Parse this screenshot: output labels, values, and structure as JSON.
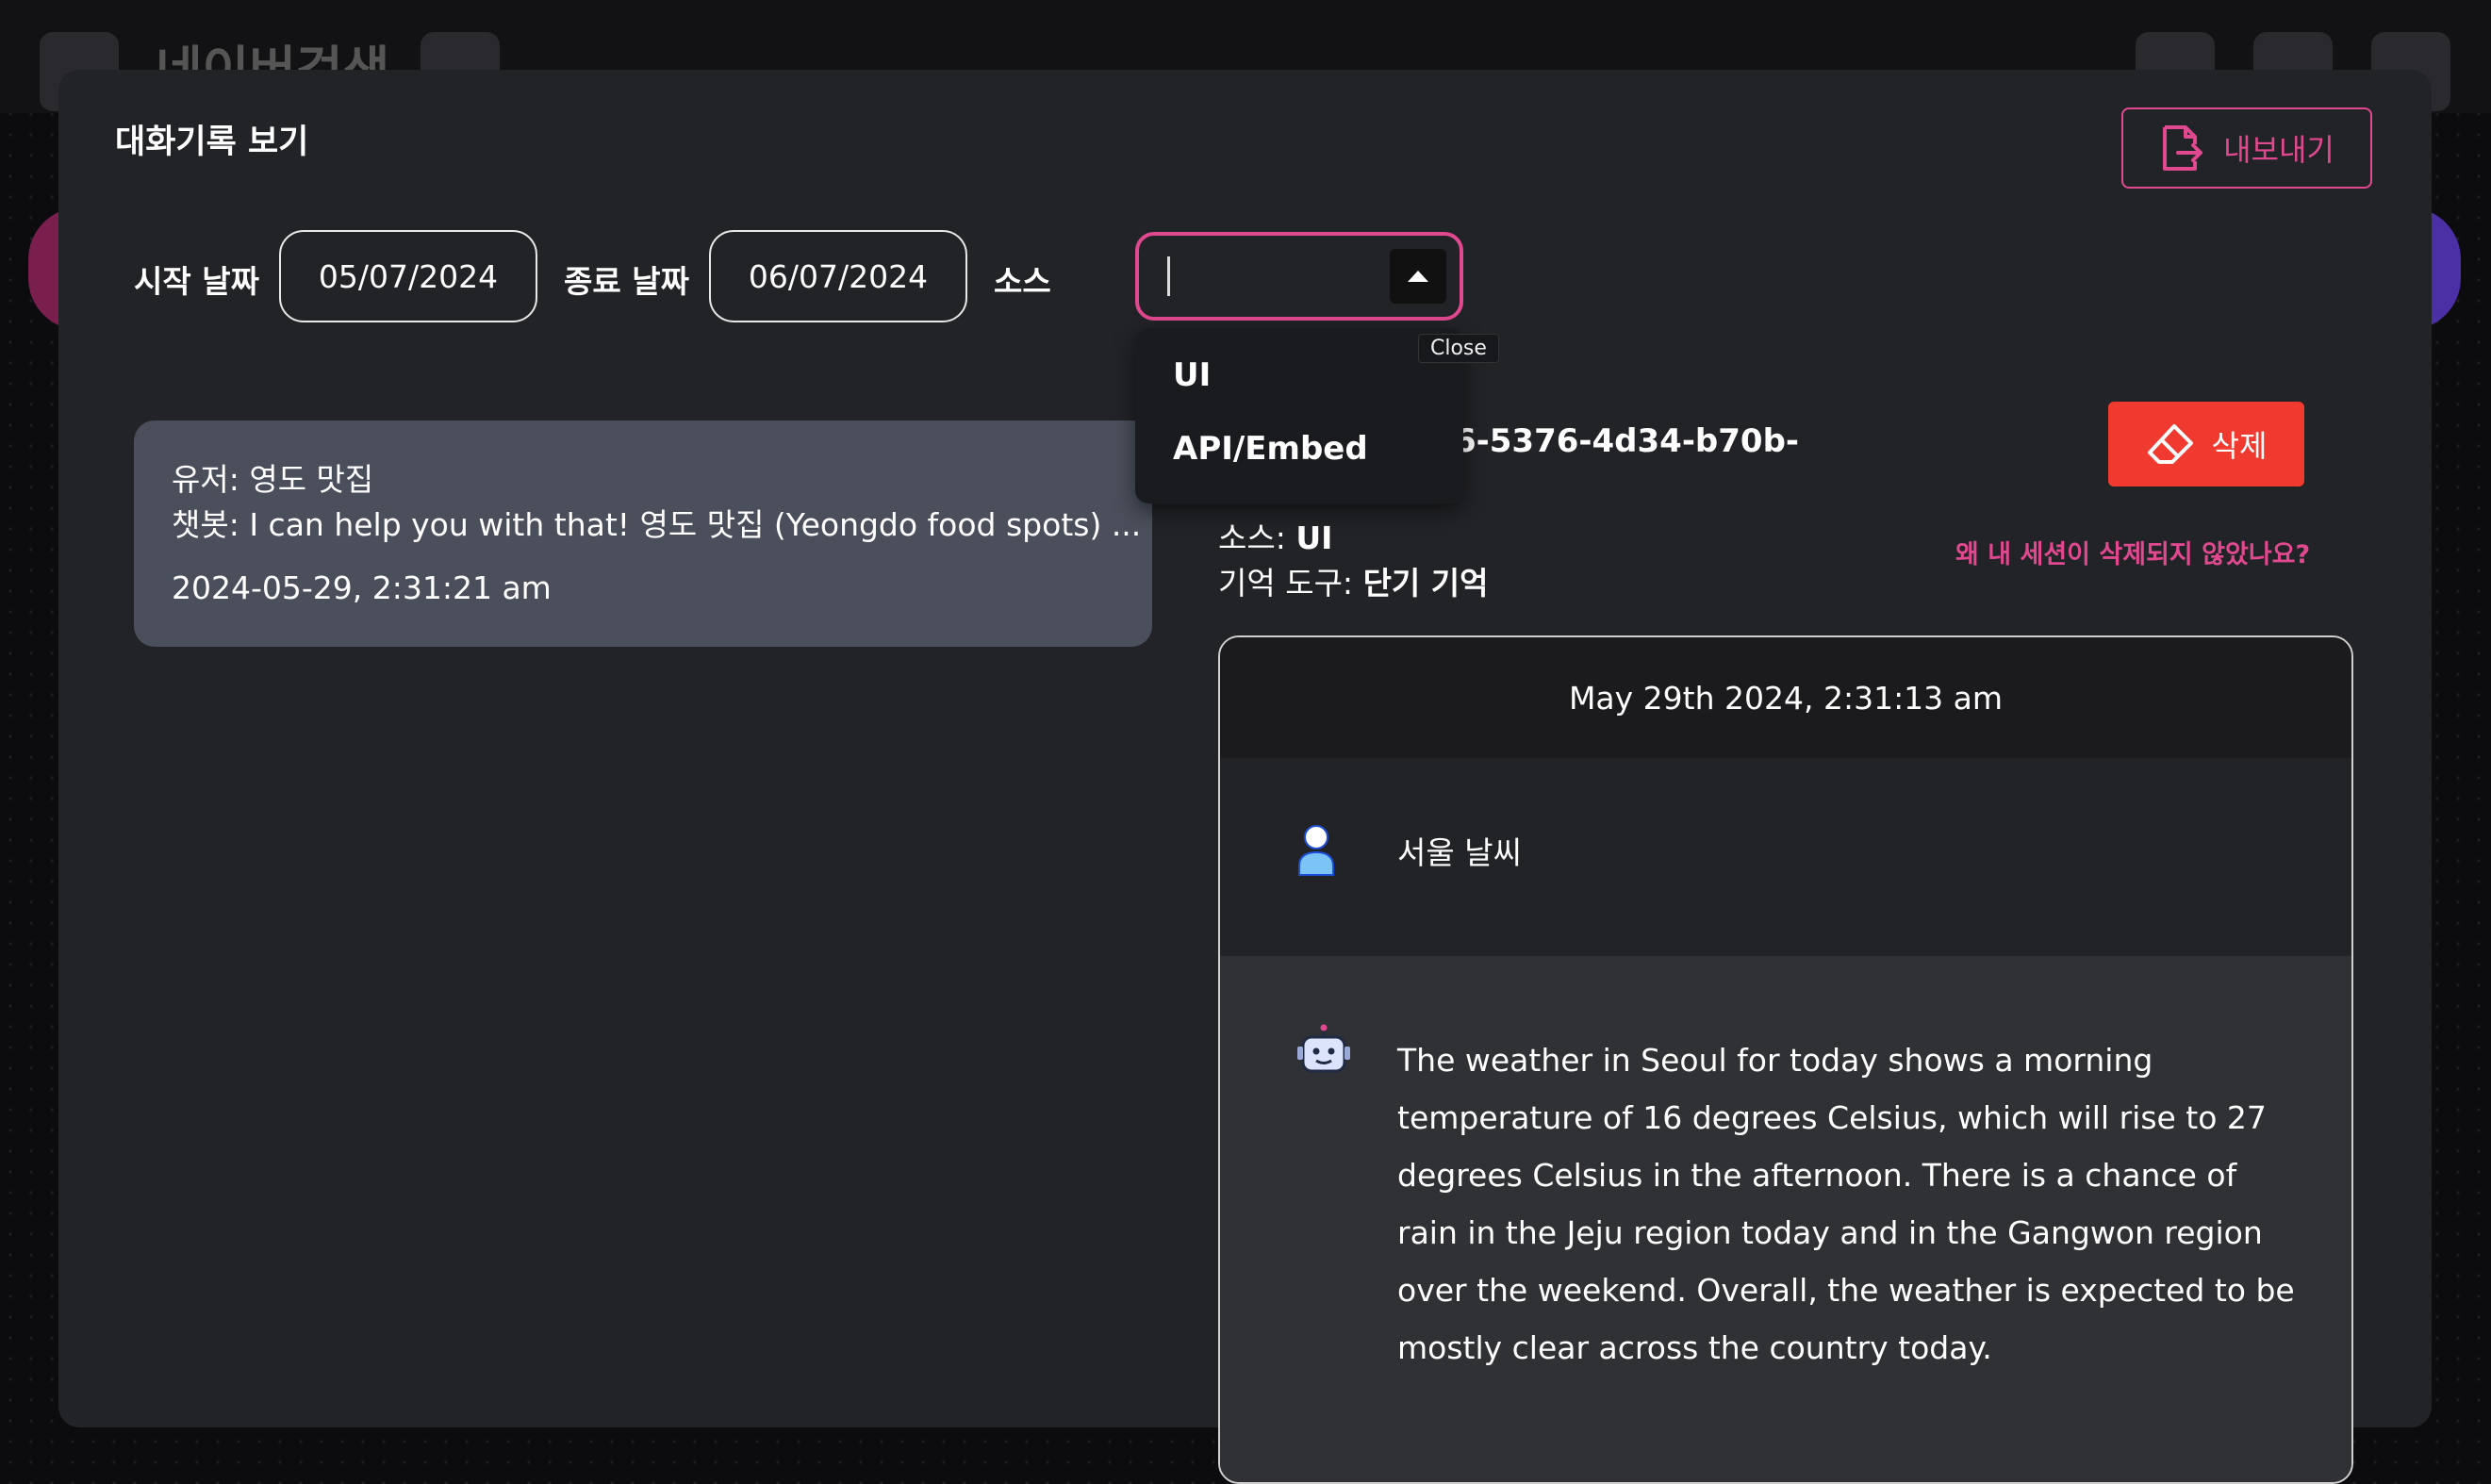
{
  "background": {
    "title": "네이버검색"
  },
  "modal": {
    "title": "대화기록 보기",
    "export_label": "내보내기",
    "close_tooltip": "Close"
  },
  "filters": {
    "start_label": "시작 날짜",
    "start_value": "05/07/2024",
    "end_label": "종료 날짜",
    "end_value": "06/07/2024",
    "source_label": "소스",
    "source_value": "",
    "source_options": [
      "UI",
      "API/Embed"
    ]
  },
  "sessions": [
    {
      "user_line": "유저: 영도 맛집",
      "bot_line": "챗봇: I can help you with that! 영도 맛집 (Yeongdo food spots) ...",
      "timestamp": "2024-05-29, 2:31:21 am"
    }
  ],
  "detail": {
    "session_id_partial": "6-5376-4d34-b70b-",
    "source_label": "소스:",
    "source_value": "UI",
    "memory_label": "기억 도구:",
    "memory_value": "단기 기억",
    "delete_label": "삭제",
    "why_link": "왜 내 세션이 삭제되지 않았나요?"
  },
  "chat": {
    "date": "May 29th 2024, 2:31:13 am",
    "user_message": "서울 날씨",
    "bot_message": "The weather in Seoul for today shows a morning temperature of 16 degrees Celsius, which will rise to 27 degrees Celsius in the afternoon. There is a chance of rain in the Jeju region today and in the Gangwon region over the weekend. Overall, the weather is expected to be mostly clear across the country today."
  },
  "colors": {
    "accent": "#e0488f",
    "danger": "#f03a2f",
    "modal_bg": "#222327",
    "card_bg": "#4a4f5b"
  }
}
